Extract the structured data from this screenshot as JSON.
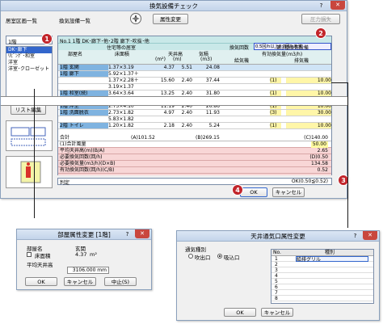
{
  "main": {
    "title": "換気設備チェック",
    "attr_button": "属性変更",
    "pressure_button": "圧力損失",
    "room_list_label": "居室区画一覧",
    "vent_list_label": "換気設備一覧",
    "floor_select": "1階",
    "room_items": [
      "DK･廊下",
      "ﾘﾋﾞﾝｸﾞ･和室",
      "洋室",
      "洋室･クローゼット"
    ],
    "list_edit_button": "リスト編集",
    "banner": "No.1 1階 DK･廊下･他･2階 廊下･吹抜･他",
    "section_left": "住宅等の居室",
    "section_right": "第3種換気設備",
    "headers": {
      "room": "部屋名",
      "area": "床面積",
      "ceiling": "天井高",
      "volume": "気積",
      "ach_prefix": "換気回数",
      "ach_value": "0.5回/h以上0.7回/h未満",
      "effective": "有効換気量(m3/h)",
      "supply": "給気機",
      "exhaust": "排気機",
      "area_unit": "(m²)",
      "ceiling_unit": "(m)",
      "volume_unit": "(m3)"
    },
    "rows": [
      {
        "room": "1階 玄関",
        "area_formula": "1.37×3.19",
        "area": "4.37",
        "ceiling": "5.51",
        "volume": "24.08",
        "sel": "",
        "exhaust": ""
      },
      {
        "room": "1階 廊下",
        "area_formula": "5.92×1.37＋",
        "area": "",
        "ceiling": "",
        "volume": "",
        "sel": "",
        "exhaust": ""
      },
      {
        "room": "",
        "area_formula": "1.37×2.28＋",
        "area": "15.60",
        "ceiling": "2.40",
        "volume": "37.44",
        "sel": "(1)",
        "exhaust": "10.00"
      },
      {
        "room": "",
        "area_formula": "3.19×1.37",
        "area": "",
        "ceiling": "",
        "volume": "",
        "sel": "",
        "exhaust": ""
      },
      {
        "room": "1階 和室(続)",
        "area_formula": "3.64×3.64",
        "area": "13.25",
        "ceiling": "2.40",
        "volume": "31.80",
        "sel": "(1)",
        "exhaust": "10.00"
      },
      {
        "room": "1階 機/衛",
        "area_formula": "2.73×1.82",
        "area": "4.99",
        "ceiling": "2.40",
        "volume": "11.98",
        "sel": "",
        "exhaust": ""
      },
      {
        "room": "1階 洋室",
        "area_formula": "2.73×4.10",
        "area": "11.19",
        "ceiling": "2.40",
        "volume": "26.86",
        "sel": "(1)",
        "exhaust": "10.00"
      },
      {
        "room": "1階 洗面脱衣",
        "area_formula": "2.73×1.82",
        "area": "4.97",
        "ceiling": "2.40",
        "volume": "11.93",
        "sel": "(3)",
        "exhaust": "30.00"
      },
      {
        "room": "",
        "area_formula": "5.83×1.82",
        "area": "",
        "ceiling": "",
        "volume": "",
        "sel": "",
        "exhaust": ""
      },
      {
        "room": "2階 トイレ",
        "area_formula": "1.20×1.82",
        "area": "2.18",
        "ceiling": "2.40",
        "volume": "5.24",
        "sel": "(1)",
        "exhaust": "10.00"
      }
    ],
    "total": {
      "label": "合計",
      "area": "(A)101.52",
      "volume": "(B)269.15",
      "exhaust": "(C)140.00"
    },
    "hall_row": {
      "label": "(1)合計風量",
      "value": "50.00"
    },
    "summary": [
      {
        "label": "平均天井高(m)(B/A)",
        "value": "2.65"
      },
      {
        "label": "必要換気回数(回/h)",
        "value": "(D)0.50"
      },
      {
        "label": "必要換気量(m3/h)(D×B)",
        "value": "134.58"
      },
      {
        "label": "有効換気回数(回/h)(C/B)",
        "value": "0.52"
      }
    ],
    "judgment_label": "判定",
    "judgment_value": "OK(0.50≦0.52)",
    "ok_button": "OK",
    "cancel_button": "キャンセル",
    "help": "?",
    "close": "✕"
  },
  "callouts": [
    "1",
    "2",
    "3",
    "4"
  ],
  "room_dialog": {
    "title": "部屋属性変更 [1階]",
    "room_label": "部屋名",
    "room_value": "玄関",
    "void_label": "床面積",
    "void_value": "4.37",
    "void_unit": "m²",
    "ceiling_label": "平均天井高",
    "ceiling_value": "3106.000 mm",
    "ok": "OK",
    "cancel": "キャンセル",
    "stop": "中止(S)",
    "help": "?",
    "close": "✕"
  },
  "vent_dialog": {
    "title": "天井通気口属性変更",
    "group_label": "通気種別",
    "radio1": "吹出口",
    "radio2": "吸込口",
    "col_no": "No.",
    "col_kind": "種別",
    "rows": [
      "1",
      "2",
      "3",
      "4",
      "5",
      "6",
      "7",
      "8"
    ],
    "first_kind": "給排グリル",
    "ok": "OK",
    "cancel": "キャンセル",
    "help": "?",
    "close": "✕"
  }
}
